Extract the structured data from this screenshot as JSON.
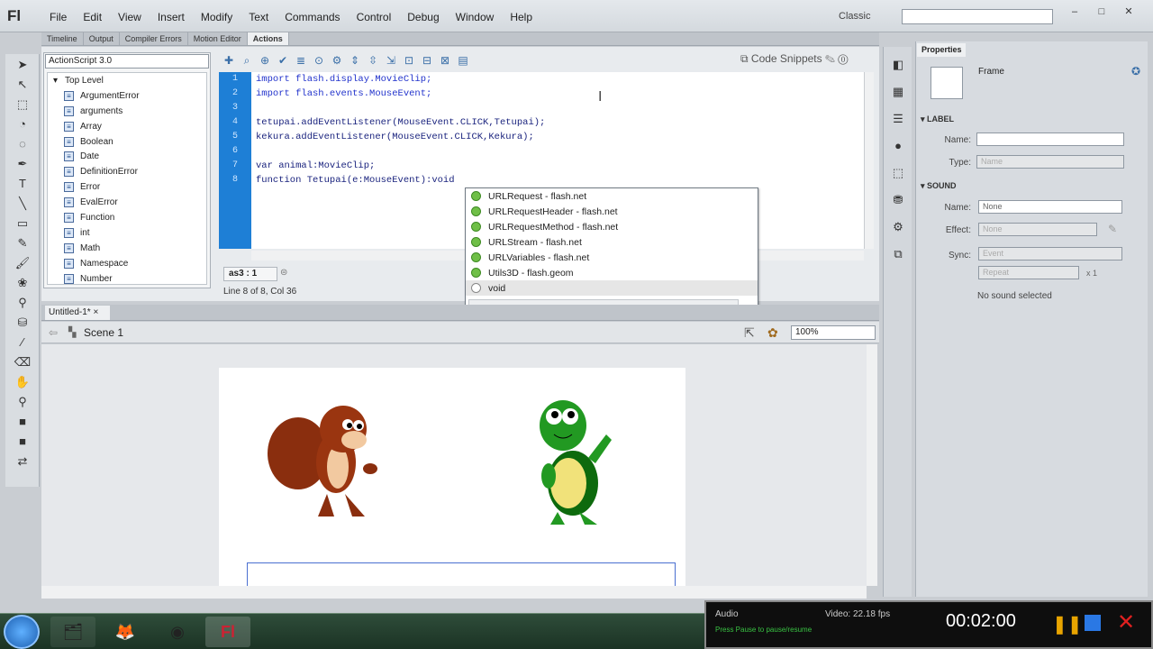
{
  "app": {
    "logo": "Fl",
    "workspace": "Classic",
    "search_placeholder": "",
    "window_buttons": [
      "–",
      "□",
      "✕"
    ]
  },
  "menu": [
    "File",
    "Edit",
    "View",
    "Insert",
    "Modify",
    "Text",
    "Commands",
    "Control",
    "Debug",
    "Window",
    "Help"
  ],
  "panel_tabs": [
    "Timeline",
    "Output",
    "Compiler Errors",
    "Motion Editor",
    "Actions"
  ],
  "actions": {
    "language": "ActionScript 3.0",
    "tree": [
      "Top Level",
      "ArgumentError",
      "arguments",
      "Array",
      "Boolean",
      "Date",
      "DefinitionError",
      "Error",
      "EvalError",
      "Function",
      "int",
      "Math",
      "Namespace",
      "Number"
    ],
    "code_snippets": "Code Snippets",
    "line_numbers": [
      "1",
      "2",
      "3",
      "4",
      "5",
      "6",
      "7",
      "8"
    ],
    "code": [
      "import flash.display.MovieClip;",
      "import flash.events.MouseEvent;",
      "",
      "tetupai.addEventListener(MouseEvent.CLICK,Tetupai);",
      "kekura.addEventListener(MouseEvent.CLICK,Kekura);",
      "",
      "var animal:MovieClip;",
      "function Tetupai(e:MouseEvent):void"
    ],
    "script_tab": "as3 : 1",
    "status": "Line 8 of 8, Col 36"
  },
  "autocomplete": [
    {
      "label": "URLRequest - flash.net",
      "selected": false
    },
    {
      "label": "URLRequestHeader - flash.net",
      "selected": false
    },
    {
      "label": "URLRequestMethod - flash.net",
      "selected": false
    },
    {
      "label": "URLStream - flash.net",
      "selected": false
    },
    {
      "label": "URLVariables - flash.net",
      "selected": false
    },
    {
      "label": "Utils3D - flash.geom",
      "selected": false
    },
    {
      "label": "void",
      "selected": true
    }
  ],
  "document": {
    "tab": "Untitled-1*",
    "scene": "Scene 1",
    "zoom": "100%"
  },
  "properties": {
    "tab": "Properties",
    "type": "Frame",
    "label_section": "LABEL",
    "name_label": "Name:",
    "type_label": "Type:",
    "type_value": "Name",
    "sound_section": "SOUND",
    "sound_name_label": "Name:",
    "sound_name_value": "None",
    "effect_label": "Effect:",
    "effect_value": "None",
    "sync_label": "Sync:",
    "sync_value": "Event",
    "repeat_value": "Repeat",
    "repeat_count": "x 1",
    "no_sound": "No sound selected"
  },
  "recorder": {
    "audio": "Audio",
    "video": "Video: 22.18 fps",
    "message": "Press Pause to pause/resume",
    "timer": "00:02:00"
  }
}
